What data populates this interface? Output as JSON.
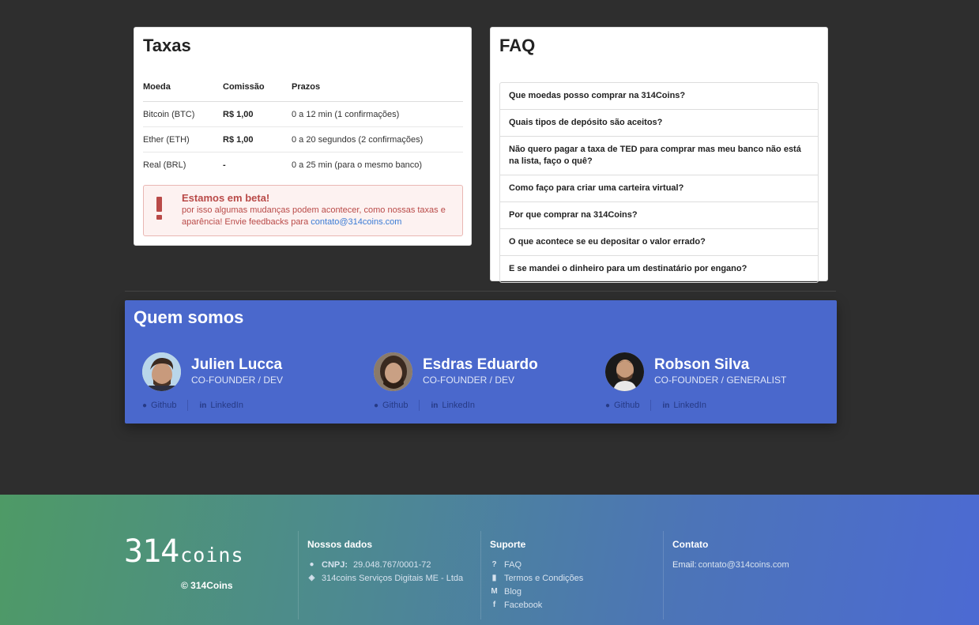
{
  "taxas": {
    "title": "Taxas",
    "headers": [
      "Moeda",
      "Comissão",
      "Prazos"
    ],
    "rows": [
      {
        "moeda": "Bitcoin (BTC)",
        "comissao": "R$ 1,00",
        "prazo": "0 a 12 min (1 confirmações)"
      },
      {
        "moeda": "Ether (ETH)",
        "comissao": "R$ 1,00",
        "prazo": "0 a 20 segundos (2 confirmações)"
      },
      {
        "moeda": "Real (BRL)",
        "comissao": "-",
        "prazo": "0 a 25 min (para o mesmo banco)"
      }
    ],
    "beta": {
      "title": "Estamos em beta!",
      "text": "por isso algumas mudanças podem acontecer, como nossas taxas e aparência! Envie feedbacks para ",
      "email": "contato@314coins.com"
    }
  },
  "faq": {
    "title": "FAQ",
    "items": [
      "Que moedas posso comprar na 314Coins?",
      "Quais tipos de depósito são aceitos?",
      "Não quero pagar a taxa de TED para comprar mas meu banco não está na lista, faço o quê?",
      "Como faço para criar uma carteira virtual?",
      "Por que comprar na 314Coins?",
      "O que acontece se eu depositar o valor errado?",
      "E se mandei o dinheiro para um destinatário por engano?"
    ]
  },
  "team": {
    "title": "Quem somos",
    "members": [
      {
        "name": "Julien Lucca",
        "role": "CO-FOUNDER / DEV",
        "github": "Github",
        "linkedin": "LinkedIn"
      },
      {
        "name": "Esdras Eduardo",
        "role": "CO-FOUNDER / DEV",
        "github": "Github",
        "linkedin": "LinkedIn"
      },
      {
        "name": "Robson Silva",
        "role": "CO-FOUNDER / GENERALIST",
        "github": "Github",
        "linkedin": "LinkedIn"
      }
    ]
  },
  "footer": {
    "logo_big": "314",
    "logo_small": "coins",
    "copyright": "© 314Coins",
    "nossos_dados": {
      "title": "Nossos dados",
      "cnpj_label": "CNPJ:",
      "cnpj": "29.048.767/0001-72",
      "company": "314coins Serviços Digitais ME - Ltda"
    },
    "suporte": {
      "title": "Suporte",
      "links": [
        "FAQ",
        "Termos e Condições",
        "Blog",
        "Facebook"
      ]
    },
    "contato": {
      "title": "Contato",
      "email_label": "Email:",
      "email": "contato@314coins.com"
    }
  }
}
